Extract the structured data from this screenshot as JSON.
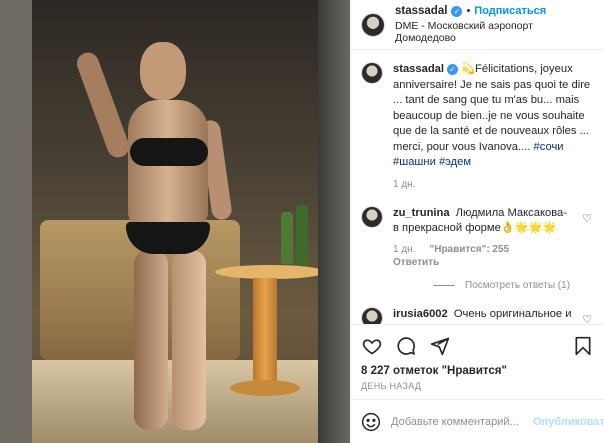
{
  "post": {
    "image_alt": "Photo"
  },
  "header": {
    "username": "stassadal",
    "separator": "•",
    "follow_label": "Подписаться",
    "location": "DME - Московский аэропорт Домодедово"
  },
  "caption": {
    "username": "stassadal",
    "text_prefix": "💫Félicitations, joyeux anniversaire! Je ne sais pas quoi te dire ... tant de sang que tu m'as bu... mais beaucoup de bien..je ne vous souhaite que de la santé et de nouveaux rôles ... merci, pour vous Ivanova....",
    "tags": [
      "#сочи",
      "#шашни",
      "#эдем"
    ],
    "age": "1 дн."
  },
  "comments": [
    {
      "username": "zu_trunina",
      "text": "Людмила Максакова- в прекрасной форме👌🌟🌟🌟",
      "age": "1 дн.",
      "likes_label": "\"Нравится\": 255",
      "reply_label": "Ответить",
      "view_replies_label": "Посмотреть ответы (1)"
    },
    {
      "username": "irusia6002",
      "text": "Очень оригинальное и неординарное"
    }
  ],
  "actions": {
    "icons": [
      "heart-icon",
      "comment-icon",
      "share-icon",
      "bookmark-icon"
    ]
  },
  "likes": {
    "count": "8 227",
    "label": "отметок",
    "suffix": "\"Нравится\""
  },
  "posted_time": "ДЕНЬ НАЗАД",
  "add_comment": {
    "placeholder": "Добавьте комментарий...",
    "publish_label": "Опубликовать"
  }
}
